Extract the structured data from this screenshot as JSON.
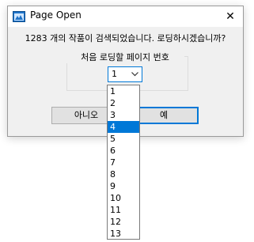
{
  "window": {
    "title": "Page Open",
    "close_symbol": "✕"
  },
  "message": "1283 개의 작품이 검색되었습니다. 로딩하시겠습니까?",
  "group": {
    "label": "처음 로딩할 페이지 번호"
  },
  "page_select": {
    "value": "1",
    "options": [
      "1",
      "2",
      "3",
      "4",
      "5",
      "6",
      "7",
      "8",
      "9",
      "10",
      "11",
      "12",
      "13"
    ],
    "highlighted": "4"
  },
  "buttons": {
    "no_label": "아니오",
    "yes_label": "예"
  },
  "colors": {
    "accent": "#0078d7",
    "dialog_bg": "#f0f0f0"
  },
  "icons": {
    "app": "app-window-icon",
    "close": "close-icon",
    "dropdown": "chevron-down-icon"
  }
}
